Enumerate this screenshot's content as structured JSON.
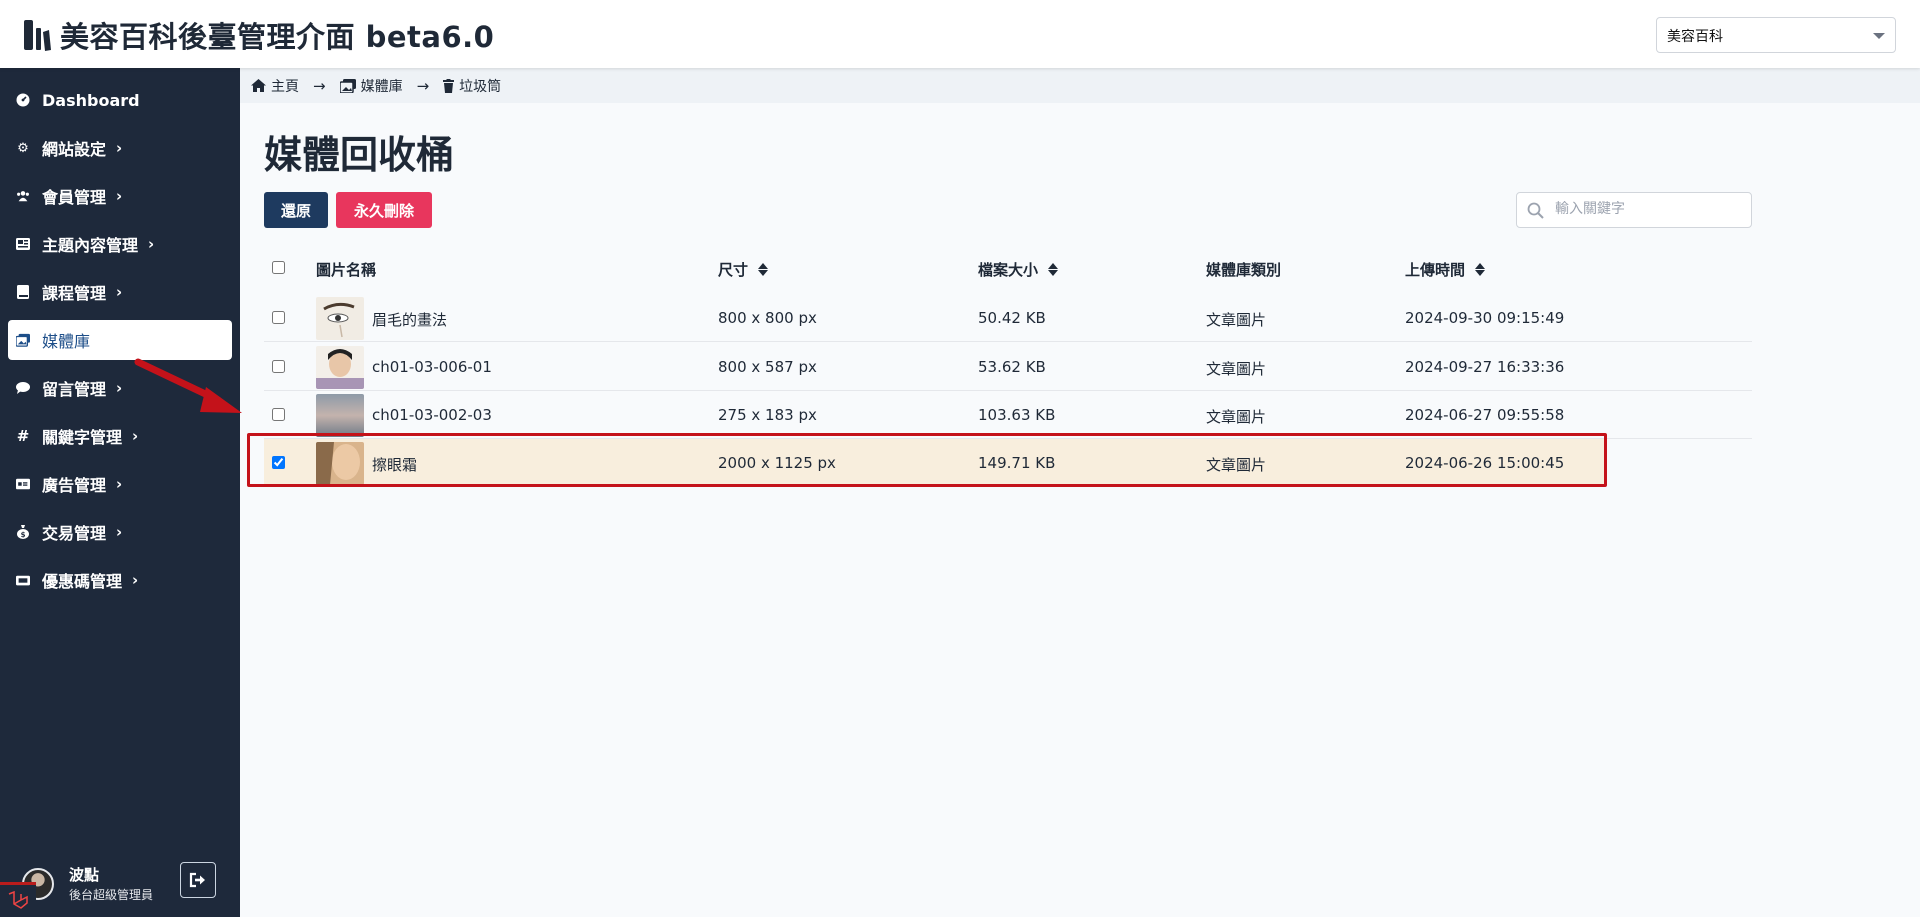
{
  "header": {
    "title": "美容百科後臺管理介面 beta6.0",
    "site_select_value": "美容百科",
    "logo_icon": "laravel-book-icon"
  },
  "sidebar": {
    "items": [
      {
        "label": "Dashboard",
        "icon": "dashboard-icon",
        "has_submenu": false,
        "active": false
      },
      {
        "label": "網站設定",
        "icon": "gear-icon",
        "has_submenu": true,
        "active": false
      },
      {
        "label": "會員管理",
        "icon": "users-icon",
        "has_submenu": true,
        "active": false
      },
      {
        "label": "主題內容管理",
        "icon": "newspaper-icon",
        "has_submenu": true,
        "active": false
      },
      {
        "label": "課程管理",
        "icon": "book-icon",
        "has_submenu": true,
        "active": false
      },
      {
        "label": "媒體庫",
        "icon": "images-icon",
        "has_submenu": false,
        "active": true
      },
      {
        "label": "留言管理",
        "icon": "comment-icon",
        "has_submenu": true,
        "active": false
      },
      {
        "label": "關鍵字管理",
        "icon": "hashtag-icon",
        "has_submenu": true,
        "active": false
      },
      {
        "label": "廣告管理",
        "icon": "ad-icon",
        "has_submenu": true,
        "active": false
      },
      {
        "label": "交易管理",
        "icon": "money-bag-icon",
        "has_submenu": true,
        "active": false
      },
      {
        "label": "優惠碼管理",
        "icon": "ticket-icon",
        "has_submenu": true,
        "active": false
      }
    ],
    "user": {
      "name": "波點",
      "role": "後台超級管理員"
    }
  },
  "breadcrumb": [
    {
      "label": "主頁",
      "icon": "home-icon"
    },
    {
      "label": "媒體庫",
      "icon": "images-icon"
    },
    {
      "label": "垃圾筒",
      "icon": "trash-icon"
    }
  ],
  "main": {
    "title": "媒體回收桶",
    "restore_label": "還原",
    "delete_label": "永久刪除",
    "search_placeholder": "輸入關鍵字",
    "columns": [
      "圖片名稱",
      "尺寸",
      "檔案大小",
      "媒體庫類別",
      "上傳時間"
    ],
    "rows": [
      {
        "name": "眉毛的畫法",
        "size": "800 x 800 px",
        "filesize": "50.42 KB",
        "category": "文章圖片",
        "uploaded": "2024-09-30 09:15:49",
        "checked": false
      },
      {
        "name": "ch01-03-006-01",
        "size": "800 x 587 px",
        "filesize": "53.62 KB",
        "category": "文章圖片",
        "uploaded": "2024-09-27 16:33:36",
        "checked": false
      },
      {
        "name": "ch01-03-002-03",
        "size": "275 x 183 px",
        "filesize": "103.63 KB",
        "category": "文章圖片",
        "uploaded": "2024-06-27 09:55:58",
        "checked": false
      },
      {
        "name": "擦眼霜",
        "size": "2000 x 1125 px",
        "filesize": "149.71 KB",
        "category": "文章圖片",
        "uploaded": "2024-06-26 15:00:45",
        "checked": true
      }
    ]
  },
  "colors": {
    "sidebar_bg": "#1e293b",
    "restore_btn": "#1e3a5f",
    "delete_btn": "#e8365d",
    "selected_row": "#f8eedd",
    "highlight": "#c4121a"
  }
}
